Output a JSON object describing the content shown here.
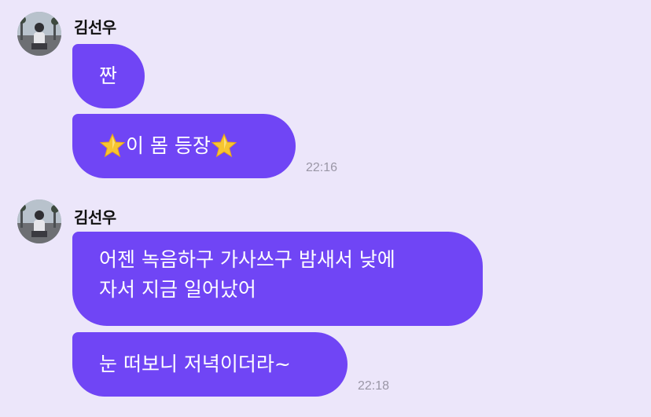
{
  "chat": {
    "groups": [
      {
        "sender": "김선우",
        "messages": [
          {
            "text": "짠"
          },
          {
            "lead_icon": "star-emoji",
            "text": "이 몸 등장",
            "trail_icon": "star-emoji"
          }
        ],
        "time": "22:16"
      },
      {
        "sender": "김선우",
        "messages": [
          {
            "lines": [
              "어젠 녹음하구 가사쓰구 밤새서 낮에",
              "자서 지금 일어났어"
            ]
          },
          {
            "text": "눈 떠보니 저녁이더라~"
          }
        ],
        "time": "22:18"
      }
    ]
  },
  "colors": {
    "background": "#ECE6FA",
    "bubble": "#7045F5",
    "bubble_text": "#FFFFFF",
    "timestamp": "#9A96A6"
  },
  "icons": {
    "avatar": "profile-photo",
    "emoji": "star-emoji"
  }
}
